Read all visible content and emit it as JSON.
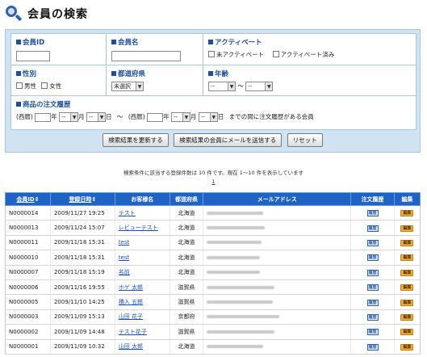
{
  "page": {
    "title": "会員の検索"
  },
  "form": {
    "member_id": {
      "label": "会員ID",
      "value": ""
    },
    "member_name": {
      "label": "会員名",
      "value": ""
    },
    "active": {
      "label": "アクティベート",
      "opt_inactive": "未アクティベート",
      "opt_active": "アクティベート済み"
    },
    "gender": {
      "label": "性別",
      "opt_male": "男性",
      "opt_female": "女性"
    },
    "prefecture": {
      "label": "都道府県",
      "selected": "未選択"
    },
    "age": {
      "label": "年齢",
      "from": "--",
      "to": "--",
      "sep": "〜"
    },
    "order_history": {
      "label": "商品の注文履歴",
      "era1": "(西暦)",
      "era2": "(西暦)",
      "year_unit": "年",
      "month_unit": "月",
      "day_unit": "日",
      "month1": "--",
      "day1": "--",
      "month2": "--",
      "day2": "--",
      "sep": "〜",
      "suffix": "までの間に注文履歴がある会員"
    },
    "buttons": {
      "update": "検索結果を更新する",
      "mail": "検索結果の会員にメールを送信する",
      "reset": "リセット"
    }
  },
  "result_info": "検索条件に該当する登録件数は 10 件です。現在 1〜10 件を表示しています",
  "pagination": "1",
  "table": {
    "headers": {
      "member_id": "会員ID",
      "registered": "登録日時",
      "name": "お客様名",
      "prefecture": "都道府県",
      "email": "メールアドレス",
      "history": "注文履歴",
      "edit": "編集"
    },
    "sort_mark": "⇕",
    "history_label": "履歴",
    "edit_label": "編集",
    "rows": [
      {
        "id": "N0000014",
        "date": "2009/11/27 19:25",
        "name": "テスト",
        "pref": "北海道"
      },
      {
        "id": "N0000013",
        "date": "2009/11/24 15:07",
        "name": "レビューテスト",
        "pref": "北海道"
      },
      {
        "id": "N0000011",
        "date": "2009/11/18 15:31",
        "name": "test",
        "pref": "北海道"
      },
      {
        "id": "N0000010",
        "date": "2009/11/18 15:31",
        "name": "test",
        "pref": "北海道"
      },
      {
        "id": "N0000007",
        "date": "2009/11/18 15:19",
        "name": "名前",
        "pref": "北海道"
      },
      {
        "id": "N0000006",
        "date": "2009/11/16 19:55",
        "name": "ホゲ 太郎",
        "pref": "滋賀県"
      },
      {
        "id": "N0000005",
        "date": "2009/11/10 14:25",
        "name": "積入 五郎",
        "pref": "滋賀県"
      },
      {
        "id": "N0000003",
        "date": "2009/11/09 15:13",
        "name": "山田 花子",
        "pref": "京都府"
      },
      {
        "id": "N0000002",
        "date": "2009/11/09 14:48",
        "name": "テスト花子",
        "pref": "滋賀県"
      },
      {
        "id": "N0000001",
        "date": "2009/11/09 10:32",
        "name": "山田 太郎",
        "pref": "北海道"
      }
    ]
  }
}
